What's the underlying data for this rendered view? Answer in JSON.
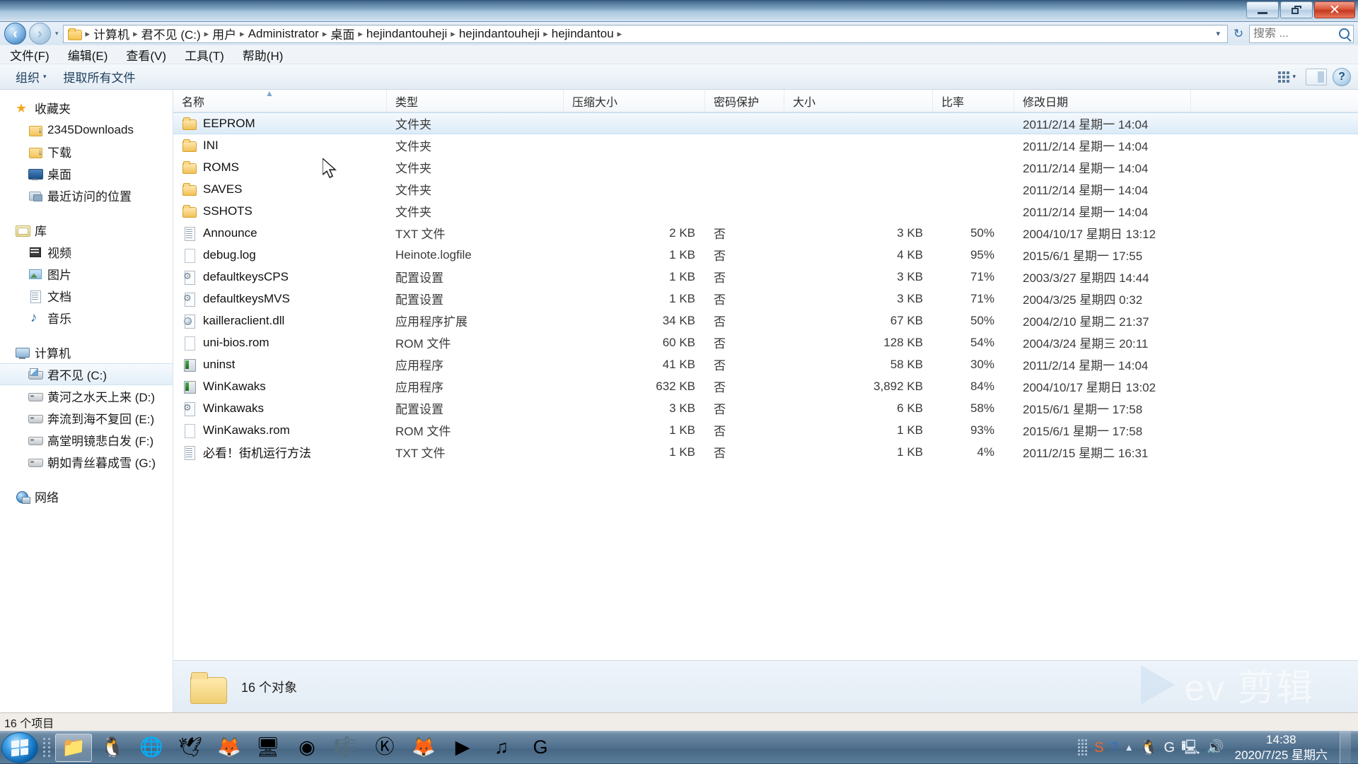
{
  "window": {
    "controls": {
      "minimize": "—",
      "maximize": "❐",
      "close": "✕"
    }
  },
  "address": {
    "back_label": "◀",
    "forward_label": "▶",
    "history_caret": "▾",
    "breadcrumbs": [
      "计算机",
      "君不见 (C:)",
      "用户",
      "Administrator",
      "桌面",
      "hejindantouheji",
      "hejindantouheji",
      "hejindantou"
    ],
    "separator": "▸",
    "dropdown_caret": "▾",
    "refresh_label": "↻"
  },
  "search": {
    "placeholder": "搜索 ...",
    "value": "",
    "icon": "search-icon"
  },
  "menu": {
    "items": [
      "文件(F)",
      "编辑(E)",
      "查看(V)",
      "工具(T)",
      "帮助(H)"
    ]
  },
  "toolbar": {
    "organize_label": "组织",
    "organize_caret": "▾",
    "extract_all_label": "提取所有文件",
    "view_caret": "▾",
    "help_label": "?"
  },
  "sidebar": {
    "groups": [
      {
        "header": {
          "label": "收藏夹",
          "icon": "star-icon"
        },
        "items": [
          {
            "label": "2345Downloads",
            "icon": "folder-icon"
          },
          {
            "label": "下载",
            "icon": "downloads-icon"
          },
          {
            "label": "桌面",
            "icon": "desktop-icon"
          },
          {
            "label": "最近访问的位置",
            "icon": "recent-places-icon"
          }
        ]
      },
      {
        "header": {
          "label": "库",
          "icon": "library-icon"
        },
        "items": [
          {
            "label": "视频",
            "icon": "video-icon"
          },
          {
            "label": "图片",
            "icon": "pictures-icon"
          },
          {
            "label": "文档",
            "icon": "documents-icon"
          },
          {
            "label": "音乐",
            "icon": "music-icon"
          }
        ]
      },
      {
        "header": {
          "label": "计算机",
          "icon": "computer-icon"
        },
        "items": [
          {
            "label": "君不见 (C:)",
            "icon": "system-drive-icon",
            "selected": true
          },
          {
            "label": "黄河之水天上来 (D:)",
            "icon": "drive-icon"
          },
          {
            "label": "奔流到海不复回 (E:)",
            "icon": "drive-icon"
          },
          {
            "label": "高堂明镜悲白发 (F:)",
            "icon": "drive-icon"
          },
          {
            "label": "朝如青丝暮成雪 (G:)",
            "icon": "drive-icon"
          }
        ]
      },
      {
        "header": {
          "label": "网络",
          "icon": "network-icon"
        },
        "items": []
      }
    ]
  },
  "filelist": {
    "columns": [
      "名称",
      "类型",
      "压缩大小",
      "密码保护",
      "大小",
      "比率",
      "修改日期"
    ],
    "sort_indicator": "▲",
    "rows": [
      {
        "name": "EEPROM",
        "icon": "folder-icon",
        "type": "文件夹",
        "packed": "",
        "protected": "",
        "size": "",
        "ratio": "",
        "date": "2011/2/14 星期一 14:04",
        "selected": true
      },
      {
        "name": "INI",
        "icon": "folder-icon",
        "type": "文件夹",
        "packed": "",
        "protected": "",
        "size": "",
        "ratio": "",
        "date": "2011/2/14 星期一 14:04"
      },
      {
        "name": "ROMS",
        "icon": "folder-icon",
        "type": "文件夹",
        "packed": "",
        "protected": "",
        "size": "",
        "ratio": "",
        "date": "2011/2/14 星期一 14:04"
      },
      {
        "name": "SAVES",
        "icon": "folder-icon",
        "type": "文件夹",
        "packed": "",
        "protected": "",
        "size": "",
        "ratio": "",
        "date": "2011/2/14 星期一 14:04"
      },
      {
        "name": "SSHOTS",
        "icon": "folder-icon",
        "type": "文件夹",
        "packed": "",
        "protected": "",
        "size": "",
        "ratio": "",
        "date": "2011/2/14 星期一 14:04"
      },
      {
        "name": "Announce",
        "icon": "text-file-icon",
        "type": "TXT 文件",
        "packed": "2 KB",
        "protected": "否",
        "size": "3 KB",
        "ratio": "50%",
        "date": "2004/10/17 星期日 13:12"
      },
      {
        "name": "debug.log",
        "icon": "blank-file-icon",
        "type": "Heinote.logfile",
        "packed": "1 KB",
        "protected": "否",
        "size": "4 KB",
        "ratio": "95%",
        "date": "2015/6/1 星期一 17:55"
      },
      {
        "name": "defaultkeysCPS",
        "icon": "config-file-icon",
        "type": "配置设置",
        "packed": "1 KB",
        "protected": "否",
        "size": "3 KB",
        "ratio": "71%",
        "date": "2003/3/27 星期四 14:44"
      },
      {
        "name": "defaultkeysMVS",
        "icon": "config-file-icon",
        "type": "配置设置",
        "packed": "1 KB",
        "protected": "否",
        "size": "3 KB",
        "ratio": "71%",
        "date": "2004/3/25 星期四 0:32"
      },
      {
        "name": "kailleraclient.dll",
        "icon": "dll-file-icon",
        "type": "应用程序扩展",
        "packed": "34 KB",
        "protected": "否",
        "size": "67 KB",
        "ratio": "50%",
        "date": "2004/2/10 星期二 21:37"
      },
      {
        "name": "uni-bios.rom",
        "icon": "blank-file-icon",
        "type": "ROM 文件",
        "packed": "60 KB",
        "protected": "否",
        "size": "128 KB",
        "ratio": "54%",
        "date": "2004/3/24 星期三 20:11"
      },
      {
        "name": "uninst",
        "icon": "exe-file-icon",
        "type": "应用程序",
        "packed": "41 KB",
        "protected": "否",
        "size": "58 KB",
        "ratio": "30%",
        "date": "2011/2/14 星期一 14:04"
      },
      {
        "name": "WinKawaks",
        "icon": "exe-file-icon",
        "type": "应用程序",
        "packed": "632 KB",
        "protected": "否",
        "size": "3,892 KB",
        "ratio": "84%",
        "date": "2004/10/17 星期日 13:02"
      },
      {
        "name": "Winkawaks",
        "icon": "config-file-icon",
        "type": "配置设置",
        "packed": "3 KB",
        "protected": "否",
        "size": "6 KB",
        "ratio": "58%",
        "date": "2015/6/1 星期一 17:58"
      },
      {
        "name": "WinKawaks.rom",
        "icon": "blank-file-icon",
        "type": "ROM 文件",
        "packed": "1 KB",
        "protected": "否",
        "size": "1 KB",
        "ratio": "93%",
        "date": "2015/6/1 星期一 17:58"
      },
      {
        "name": "必看！街机运行方法",
        "icon": "text-file-icon",
        "type": "TXT 文件",
        "packed": "1 KB",
        "protected": "否",
        "size": "1 KB",
        "ratio": "4%",
        "date": "2011/2/15 星期二 16:31"
      }
    ]
  },
  "details_pane": {
    "object_count": "16 个对象",
    "icon": "folder-icon"
  },
  "watermark": {
    "text": "ev 剪辑",
    "icon": "play-triangle-icon"
  },
  "statusbar": {
    "item_count": "16 个项目"
  },
  "taskbar": {
    "start_label": "start-orb",
    "apps": [
      {
        "name": "file-explorer",
        "glyph": "📁",
        "active": true
      },
      {
        "name": "qq-messenger",
        "glyph": "🐧"
      },
      {
        "name": "internet-explorer",
        "glyph": "🌐"
      },
      {
        "name": "thunderbird-mail",
        "glyph": "🕊"
      },
      {
        "name": "foxmail",
        "glyph": "🦊"
      },
      {
        "name": "remote-desktop",
        "glyph": "🖥"
      },
      {
        "name": "google-chrome",
        "glyph": "◉"
      },
      {
        "name": "kugou-music",
        "glyph": "🎼"
      },
      {
        "name": "kingsoft-app",
        "glyph": "Ⓚ"
      },
      {
        "name": "firefox-browser",
        "glyph": "🦊"
      },
      {
        "name": "media-player",
        "glyph": "▶"
      },
      {
        "name": "music-player",
        "glyph": "♫"
      },
      {
        "name": "logitech-gaming",
        "glyph": "G"
      }
    ],
    "tray": [
      {
        "name": "sogou-input",
        "glyph": "S"
      },
      {
        "name": "help-question",
        "glyph": "?"
      },
      {
        "name": "show-hidden-icons",
        "glyph": "▲"
      },
      {
        "name": "qq-tray",
        "glyph": "🐧"
      },
      {
        "name": "logitech-tray",
        "glyph": "G"
      },
      {
        "name": "network-tray",
        "glyph": "🖳"
      },
      {
        "name": "volume-tray",
        "glyph": "🔊"
      }
    ],
    "clock": {
      "time": "14:38",
      "date": "2020/7/25 星期六"
    }
  }
}
